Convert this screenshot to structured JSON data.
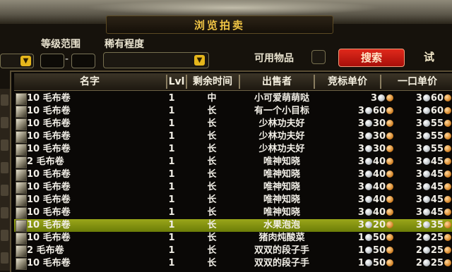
{
  "window": {
    "title": "浏览拍卖"
  },
  "filters": {
    "level_range_label": "等级范围",
    "rarity_label": "稀有程度",
    "level_range_separator": "-",
    "usable_items_label": "可用物品",
    "search_button": "搜索",
    "try_label": "试"
  },
  "columns": [
    "名字",
    "Lvl",
    "剩余时间",
    "出售者",
    "竞标单价",
    "一口单价"
  ],
  "rows": [
    {
      "name": "10 毛布卷",
      "lvl": "1",
      "time": "中",
      "seller": "小可爱萌萌哒",
      "bid_gold": "3",
      "bid_silver": "",
      "bid_copper_icon": true,
      "buy_gold": "3",
      "buy_silver": "60"
    },
    {
      "name": "10 毛布卷",
      "lvl": "1",
      "time": "长",
      "seller": "有一个小目标",
      "bid_gold": "3",
      "bid_silver": "60",
      "buy_gold": "3",
      "buy_silver": "60"
    },
    {
      "name": "10 毛布卷",
      "lvl": "1",
      "time": "长",
      "seller": "少林功夫好",
      "bid_gold": "3",
      "bid_silver": "30",
      "buy_gold": "3",
      "buy_silver": "55"
    },
    {
      "name": "10 毛布卷",
      "lvl": "1",
      "time": "长",
      "seller": "少林功夫好",
      "bid_gold": "3",
      "bid_silver": "30",
      "buy_gold": "3",
      "buy_silver": "55"
    },
    {
      "name": "10 毛布卷",
      "lvl": "1",
      "time": "长",
      "seller": "少林功夫好",
      "bid_gold": "3",
      "bid_silver": "30",
      "buy_gold": "3",
      "buy_silver": "55"
    },
    {
      "name": "2 毛布卷",
      "lvl": "1",
      "time": "长",
      "seller": "唯神知晓",
      "bid_gold": "3",
      "bid_silver": "40",
      "buy_gold": "3",
      "buy_silver": "45"
    },
    {
      "name": "10 毛布卷",
      "lvl": "1",
      "time": "长",
      "seller": "唯神知晓",
      "bid_gold": "3",
      "bid_silver": "40",
      "buy_gold": "3",
      "buy_silver": "45"
    },
    {
      "name": "10 毛布卷",
      "lvl": "1",
      "time": "长",
      "seller": "唯神知晓",
      "bid_gold": "3",
      "bid_silver": "40",
      "buy_gold": "3",
      "buy_silver": "45"
    },
    {
      "name": "10 毛布卷",
      "lvl": "1",
      "time": "长",
      "seller": "唯神知晓",
      "bid_gold": "3",
      "bid_silver": "40",
      "buy_gold": "3",
      "buy_silver": "45"
    },
    {
      "name": "10 毛布卷",
      "lvl": "1",
      "time": "长",
      "seller": "唯神知晓",
      "bid_gold": "3",
      "bid_silver": "40",
      "buy_gold": "3",
      "buy_silver": "45"
    },
    {
      "name": "10 毛布卷",
      "lvl": "1",
      "time": "长",
      "seller": "水果泡泡",
      "bid_gold": "3",
      "bid_silver": "20",
      "buy_gold": "3",
      "buy_silver": "35",
      "selected": true
    },
    {
      "name": "10 毛布卷",
      "lvl": "1",
      "time": "长",
      "seller": "猪肉炖酸菜",
      "bid_gold": "1",
      "bid_silver": "50",
      "buy_gold": "2",
      "buy_silver": "25"
    },
    {
      "name": "2 毛布卷",
      "lvl": "1",
      "time": "长",
      "seller": "双双的段子手",
      "bid_gold": "1",
      "bid_silver": "50",
      "buy_gold": "2",
      "buy_silver": "25"
    },
    {
      "name": "10 毛布卷",
      "lvl": "1",
      "time": "长",
      "seller": "双双的段子手",
      "bid_gold": "1",
      "bid_silver": "50",
      "buy_gold": "2",
      "buy_silver": "25"
    }
  ],
  "colors": {
    "title": "#f0c445",
    "highlight": "#8e9c12",
    "search_button": "#d21f14"
  }
}
